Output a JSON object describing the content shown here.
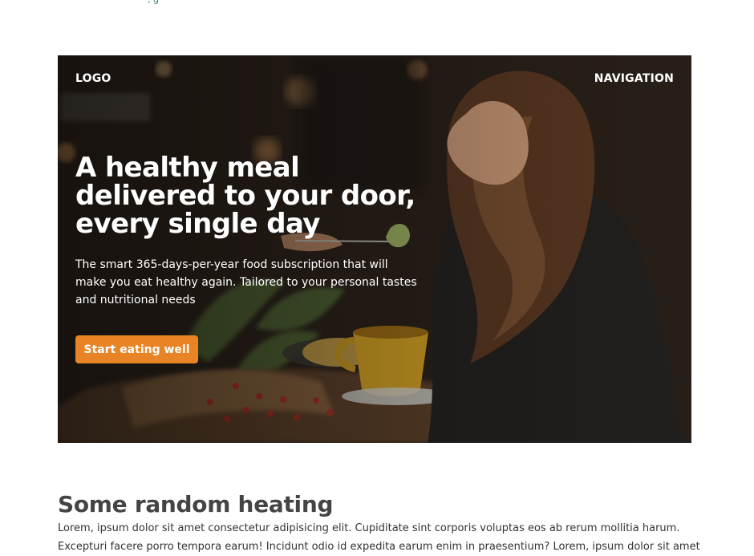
{
  "top_fragment": {
    "text": ", g"
  },
  "hero": {
    "logo": "LOGO",
    "navigation": "NAVIGATION",
    "title": "A healthy meal delivered to your door, every single day",
    "subtitle": "The smart 365-days-per-year food subscription that will make you eat healthy again. Tailored to your personal tastes and nutritional needs",
    "cta_label": "Start eating well",
    "image_subject": "woman eating at restaurant table with coffee cup and salad",
    "accent_color": "#e88426"
  },
  "section": {
    "heading": "Some random heating",
    "body_line_1": "Lorem, ipsum dolor sit amet consectetur adipisicing elit. Cupiditate sint corporis voluptas eos ab rerum mollitia harum.",
    "body_line_2": "Excepturi facere porro tempora earum! Incidunt odio id expedita earum enim in praesentium? Lorem, ipsum dolor sit amet"
  }
}
